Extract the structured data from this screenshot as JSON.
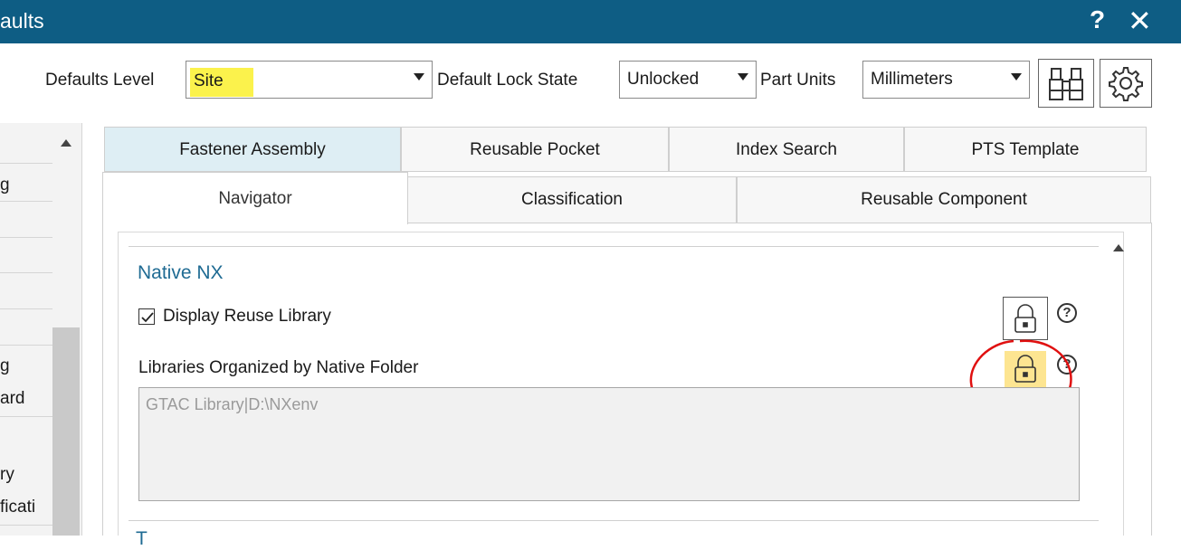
{
  "window": {
    "title": "aults",
    "help_label": "?",
    "close_label": "✕"
  },
  "toolbar": {
    "defaults_level_label": "Defaults Level",
    "defaults_level_value": "Site",
    "lock_state_label": "Default Lock State",
    "lock_state_value": "Unlocked",
    "part_units_label": "Part Units",
    "part_units_value": "Millimeters",
    "find_icon": "binoculars-icon",
    "settings_icon": "gear-icon"
  },
  "left_panel": {
    "items": [
      "g",
      "g",
      "ard",
      "ry",
      "ficati"
    ]
  },
  "tabs": {
    "row1": [
      "Fastener Assembly",
      "Reusable Pocket",
      "Index Search",
      "PTS Template"
    ],
    "row2": [
      "Navigator",
      "Classification",
      "Reusable Component"
    ],
    "active": "Navigator"
  },
  "content": {
    "section_title": "Native NX",
    "display_reuse_label": "Display Reuse Library",
    "display_reuse_checked": true,
    "libraries_label": "Libraries Organized by Native Folder",
    "libraries_value": "GTAC Library|D:\\NXenv",
    "next_section_partial": "T"
  },
  "colors": {
    "titlebar": "#0e5d84",
    "section_title": "#1f6b93",
    "highlight": "#fbf24c",
    "lock_highlight": "#fde591",
    "annotation": "#e01010"
  }
}
